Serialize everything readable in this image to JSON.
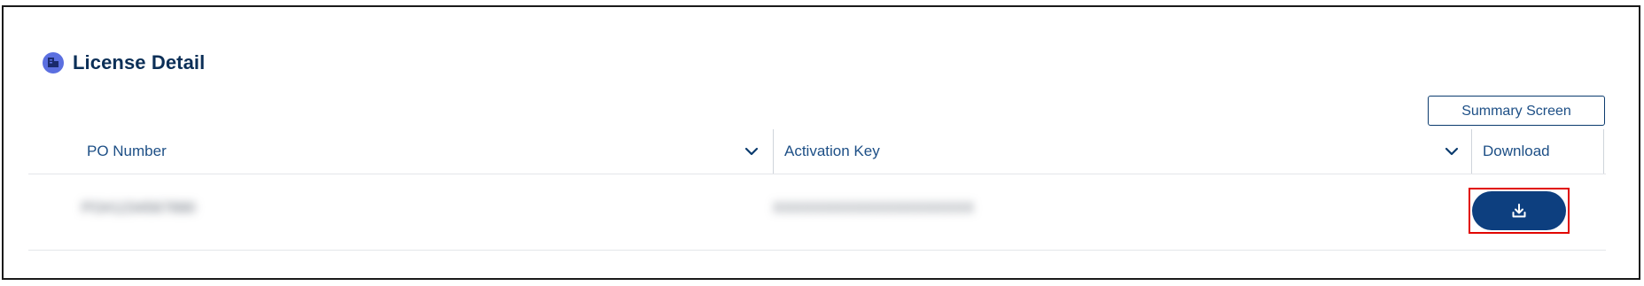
{
  "card": {
    "title": "License Detail",
    "title_icon": "license-icon"
  },
  "summary_button": {
    "label": "Summary Screen"
  },
  "table": {
    "columns": [
      {
        "label": "PO Number",
        "icon": "chevron-down-icon"
      },
      {
        "label": "Activation Key",
        "icon": "chevron-down-icon"
      },
      {
        "label": "Download"
      }
    ],
    "rows": [
      {
        "po_number": "PO#1234567890",
        "activation_key": "XXXXXXXXXXXXXXXXXXXX",
        "download_icon": "download-icon"
      }
    ]
  },
  "colors": {
    "primary": "#0d3f7f",
    "text": "#1d4f86",
    "title_icon_bg": "#5b6fe0",
    "highlight": "#e10600"
  }
}
